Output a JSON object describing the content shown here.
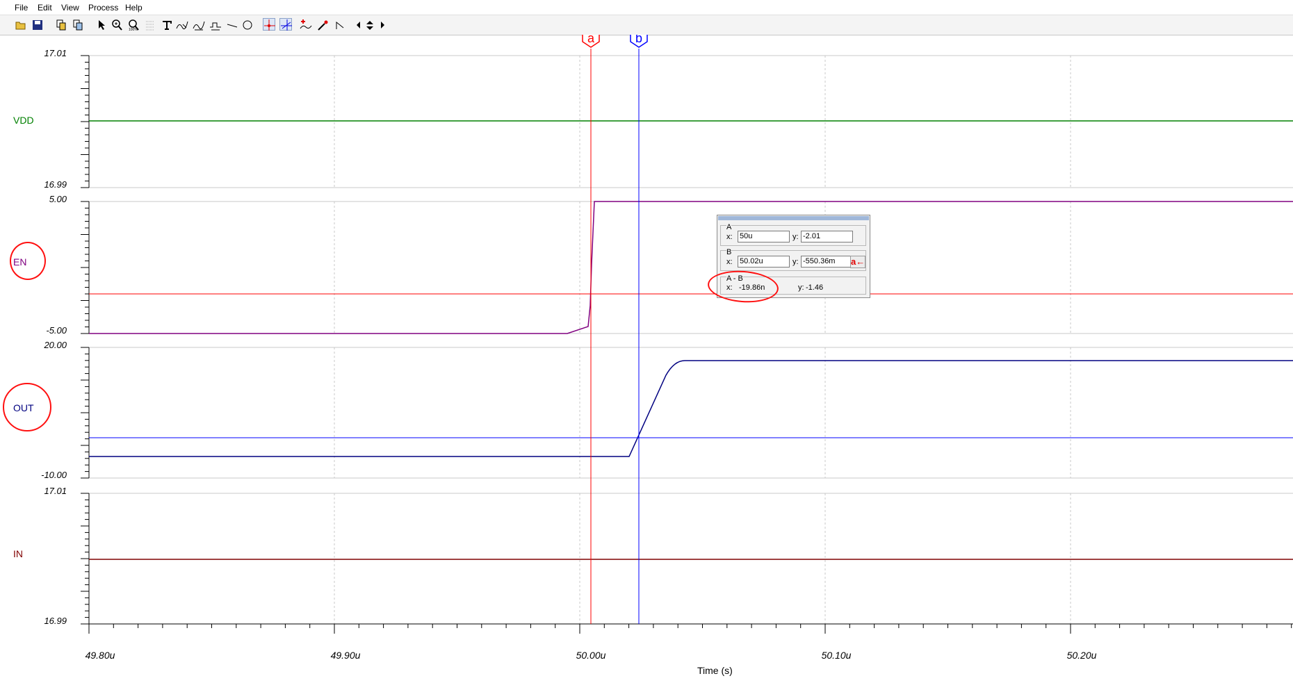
{
  "menu": [
    "File",
    "Edit",
    "View",
    "Process",
    "Help"
  ],
  "toolbar_icons": [
    "open-folder-icon",
    "save-icon",
    "copy-icon",
    "copy-special-icon",
    "pointer-icon",
    "zoom-in-icon",
    "zoom-window-icon",
    "grid-icon",
    "text-icon",
    "draw-wave-icon",
    "draw-wave2-icon",
    "draw-wave3-icon",
    "line-icon",
    "circle-icon",
    "cursor-a-icon",
    "cursor-b-icon",
    "add-cursor-icon",
    "probe-icon",
    "arrow-line-icon",
    "scroll-left-icon",
    "scroll-updown-icon",
    "scroll-right-icon"
  ],
  "colors": {
    "vdd": "#008000",
    "en": "#800080",
    "out": "#000080",
    "in": "#800000",
    "cursor_a": "#ff0000",
    "cursor_b": "#0000ff",
    "annotation": "#ff1010"
  },
  "signals": [
    {
      "name": "VDD",
      "ymax": "17.01",
      "ymin": "16.99",
      "color": "#008000"
    },
    {
      "name": "EN",
      "ymax": "5.00",
      "ymin": "-5.00",
      "color": "#800080"
    },
    {
      "name": "OUT",
      "ymax": "20.00",
      "ymin": "-10.00",
      "color": "#000080"
    },
    {
      "name": "IN",
      "ymax": "17.01",
      "ymin": "16.99",
      "color": "#800000"
    }
  ],
  "xaxis": {
    "label": "Time (s)",
    "ticks": [
      "49.80u",
      "49.90u",
      "50.00u",
      "50.10u",
      "50.20u"
    ]
  },
  "cursors": {
    "a_label": "a",
    "b_label": "b"
  },
  "cursor_panel": {
    "a": {
      "title": "A",
      "x_label": "x:",
      "x": "50u",
      "y_label": "y:",
      "y": "-2.01"
    },
    "b": {
      "title": "B",
      "x_label": "x:",
      "x": "50.02u",
      "y_label": "y:",
      "y": "-550.36m",
      "button": "a←"
    },
    "diff": {
      "title": "A - B",
      "x_label": "x:",
      "x": "-19.86n",
      "y_label": "y:",
      "y": "-1.46"
    }
  }
}
